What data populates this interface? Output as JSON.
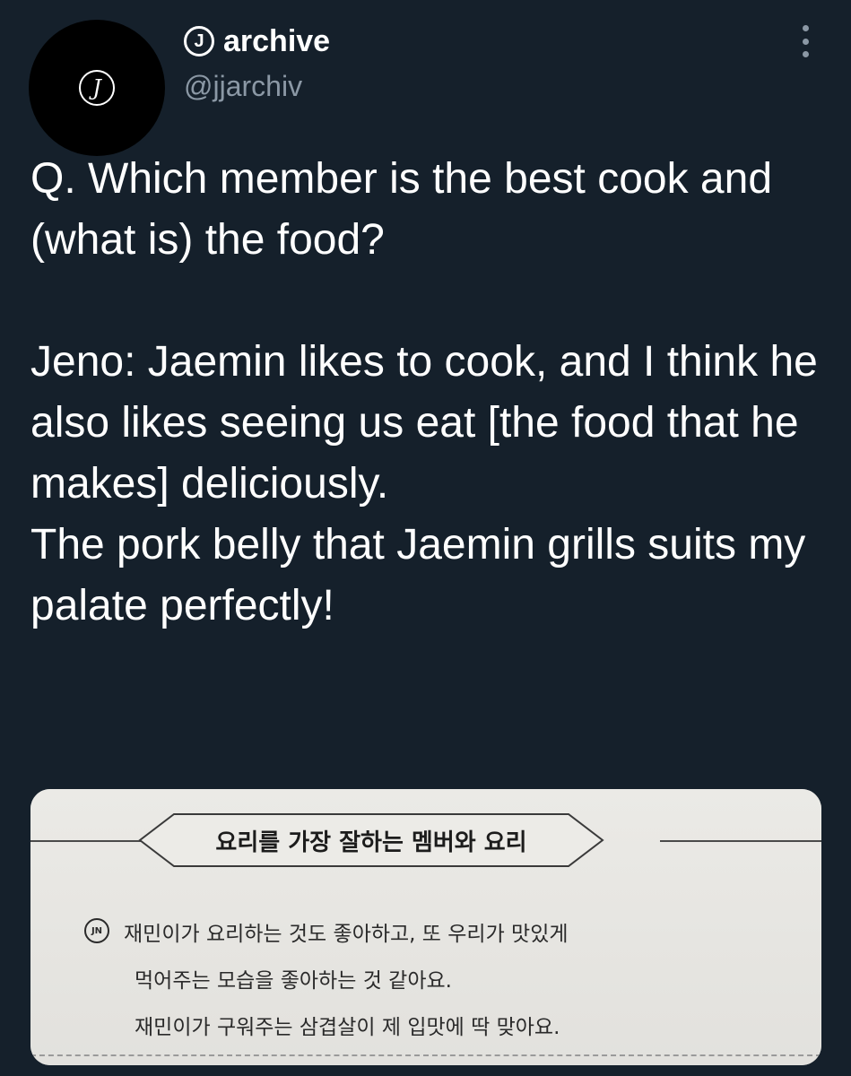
{
  "header": {
    "avatar_icon": "circled-j-logo",
    "badge_letter": "J",
    "display_name": "archive",
    "handle": "@jjarchiv",
    "more_icon": "vertical-ellipsis-icon"
  },
  "tweet": {
    "question": "Q. Which member is the best cook and (what is) the food?",
    "answer_lines": [
      "Jeno: Jaemin likes to cook, and I think he also likes seeing us eat [the food that he makes] deliciously.",
      "The pork belly that Jaemin grills suits my palate perfectly!"
    ]
  },
  "media": {
    "section_title": "요리를 가장 잘하는 멤버와 요리",
    "speaker_tag": "JN",
    "lines": [
      "재민이가 요리하는 것도 좋아하고, 또 우리가 맛있게",
      "먹어주는 모습을 좋아하는 것 같아요.",
      "재민이가 구워주는 삼겹살이 제 입맛에 딱 맞아요."
    ]
  },
  "colors": {
    "background": "#15202b",
    "text_primary": "#ffffff",
    "text_secondary": "#8b98a5",
    "paper": "#e6e5e1"
  }
}
